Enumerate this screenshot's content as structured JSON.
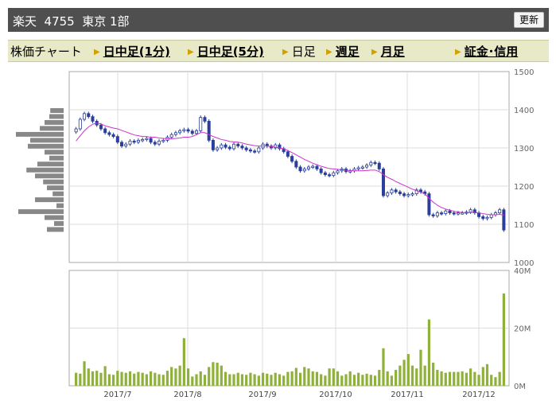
{
  "header": {
    "title": "楽天  4755  東京 1部",
    "refresh_label": "更新"
  },
  "tabs": {
    "label": "株価チャート",
    "items": [
      {
        "label": "日中足(1分)",
        "link": true
      },
      {
        "label": "日中足(5分)",
        "link": true
      },
      {
        "label": "日足",
        "link": false
      },
      {
        "label": "週足",
        "link": true
      },
      {
        "label": "月足",
        "link": true
      },
      {
        "label": "証金･信用",
        "link": true
      }
    ]
  },
  "colors": {
    "candle": "#2a3f9a",
    "moving_average": "#cc33cc",
    "volume": "#8fb13a",
    "volume_profile": "#888888",
    "grid": "#dddddd"
  },
  "chart_data": [
    {
      "type": "candlestick",
      "title": "",
      "x_tick_labels": [
        "2017/7",
        "2017/8",
        "2017/9",
        "2017/10",
        "2017/11",
        "2017/12"
      ],
      "y_tick_labels": [
        "1500",
        "1400",
        "1300",
        "1200",
        "1100",
        "1000"
      ],
      "ylim": [
        1000,
        1500
      ],
      "grid": true,
      "close": [
        1350,
        1375,
        1390,
        1382,
        1370,
        1360,
        1350,
        1340,
        1335,
        1330,
        1315,
        1305,
        1310,
        1318,
        1315,
        1320,
        1322,
        1325,
        1315,
        1310,
        1318,
        1320,
        1328,
        1335,
        1340,
        1345,
        1348,
        1344,
        1338,
        1345,
        1380,
        1370,
        1320,
        1295,
        1300,
        1308,
        1302,
        1298,
        1310,
        1305,
        1300,
        1295,
        1292,
        1290,
        1300,
        1310,
        1305,
        1300,
        1308,
        1298,
        1290,
        1278,
        1265,
        1250,
        1240,
        1245,
        1250,
        1252,
        1245,
        1235,
        1230,
        1228,
        1235,
        1240,
        1245,
        1238,
        1240,
        1245,
        1248,
        1250,
        1255,
        1262,
        1260,
        1245,
        1175,
        1182,
        1190,
        1185,
        1180,
        1175,
        1178,
        1180,
        1190,
        1185,
        1180,
        1125,
        1122,
        1130,
        1128,
        1135,
        1130,
        1128,
        1130,
        1130,
        1132,
        1138,
        1130,
        1120,
        1115,
        1118,
        1125,
        1130,
        1138,
        1085
      ],
      "moving_average": [
        1318,
        1332,
        1345,
        1355,
        1362,
        1365,
        1363,
        1358,
        1355,
        1352,
        1350,
        1346,
        1342,
        1338,
        1334,
        1332,
        1330,
        1330,
        1328,
        1328,
        1326,
        1325,
        1324,
        1324,
        1325,
        1326,
        1328,
        1328,
        1330,
        1335,
        1340,
        1340,
        1335,
        1330,
        1326,
        1322,
        1320,
        1317,
        1316,
        1315,
        1313,
        1310,
        1308,
        1306,
        1305,
        1305,
        1305,
        1303,
        1302,
        1300,
        1298,
        1293,
        1288,
        1282,
        1276,
        1270,
        1265,
        1260,
        1256,
        1252,
        1249,
        1246,
        1245,
        1244,
        1243,
        1242,
        1241,
        1240,
        1240,
        1240,
        1241,
        1242,
        1242,
        1238,
        1230,
        1223,
        1218,
        1212,
        1207,
        1202,
        1197,
        1192,
        1188,
        1184,
        1180,
        1168,
        1158,
        1150,
        1144,
        1140,
        1137,
        1134,
        1132,
        1131,
        1130,
        1131,
        1131,
        1130,
        1128,
        1126,
        1125,
        1125,
        1126,
        1124
      ]
    },
    {
      "type": "bar",
      "title": "",
      "y_tick_labels": [
        "40M",
        "20M",
        "0M"
      ],
      "ylim": [
        0,
        40
      ],
      "values": [
        4.5,
        4.2,
        8.5,
        6,
        5,
        5.2,
        4.5,
        6.8,
        4,
        3.8,
        5.2,
        4.8,
        4.5,
        5,
        4.2,
        4.8,
        4.5,
        4,
        5,
        4.5,
        4,
        3.8,
        5.2,
        6.5,
        6,
        7,
        16.5,
        6,
        3.2,
        4,
        5,
        3.8,
        6.5,
        8.2,
        8,
        7,
        4.8,
        4,
        4,
        4.5,
        4,
        3.8,
        4.5,
        4,
        3.5,
        4.5,
        4.2,
        3.8,
        4.5,
        4,
        3.5,
        4.8,
        5,
        6.2,
        4.5,
        6.5,
        6,
        5,
        4.8,
        4,
        3.5,
        6,
        6,
        5,
        3.5,
        4,
        5,
        3.8,
        4.5,
        3.8,
        4.2,
        3.8,
        3.5,
        5.5,
        13,
        5,
        3.5,
        5.5,
        7,
        9,
        11,
        7,
        6,
        12.5,
        7,
        23,
        8,
        5.5,
        5,
        4.5,
        4.8,
        4.8,
        4.8,
        5,
        4.5,
        6,
        4.8,
        3.8,
        6.5,
        7.5,
        3.8,
        3,
        4.8,
        32
      ]
    },
    {
      "type": "volume_profile",
      "title": "",
      "values": [
        0.28,
        0.3,
        0.4,
        0.5,
        1.0,
        0.7,
        0.75,
        0.4,
        0.3,
        0.55,
        0.78,
        0.6,
        0.43,
        0.35,
        0.23,
        0.6,
        0.15,
        0.95,
        0.4,
        0.2,
        0.35
      ]
    }
  ]
}
